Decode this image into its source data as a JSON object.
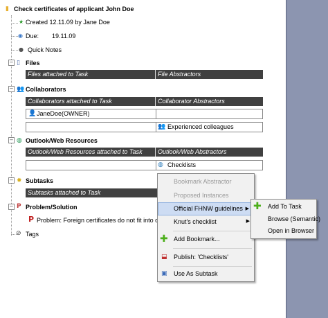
{
  "root": {
    "title": "Check certificates of applicant John Doe"
  },
  "meta": {
    "created": "Created 12.11.09 by Jane Doe",
    "due_label": "Due:",
    "due_value": "19.11.09",
    "quick_notes": "Quick Notes"
  },
  "files": {
    "title": "Files",
    "col1": "Files attached to Task",
    "col2": "File Abstractors"
  },
  "collaborators": {
    "title": "Collaborators",
    "col1": "Collaborators attached to Task",
    "col2": "Collaborator Abstractors",
    "person": "JaneDoe(OWNER)",
    "abstractor": "Experienced colleagues"
  },
  "outlook": {
    "title": "Outlook/Web Resources",
    "col1": "Outlook/Web Resources attached to Task",
    "col2": "Outlook/Web Abstractors",
    "abstractor": "Checklists"
  },
  "subtasks": {
    "title": "Subtasks",
    "col1": "Subtasks attached to Task"
  },
  "problem": {
    "title": "Problem/Solution",
    "item": "Problem: Foreign certificates do not fit into our"
  },
  "tags": {
    "title": "Tags"
  },
  "context_menu": {
    "bookmark_abstractor": "Bookmark Abstractor",
    "proposed_instances": "Proposed Instances",
    "fhnw_guidelines": "Official FHNW guidelines",
    "knuts_checklist": "Knut's checklist",
    "add_bookmark": "Add Bookmark...",
    "publish": "Publish: 'Checklists'",
    "use_as_subtask": "Use As Subtask"
  },
  "submenu": {
    "add_to_task": "Add To Task",
    "browse": "Browse (Semantic)",
    "open_browser": "Open in Browser"
  },
  "colors": {
    "header_bg": "#404040",
    "menu_bg": "#f1f1f1",
    "highlight": "#cddcf3",
    "side_panel": "#8c95b0"
  }
}
